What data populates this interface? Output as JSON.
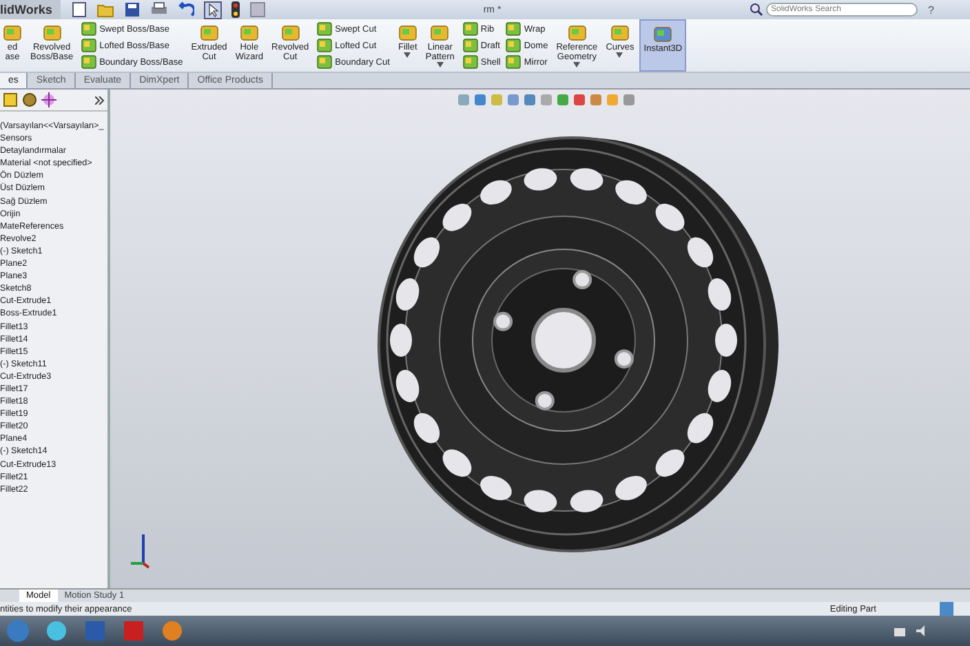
{
  "title_bar": {
    "logo": "lidWorks",
    "document_title": "rm *",
    "search": {
      "placeholder": "SolidWorks Search"
    },
    "help": "?"
  },
  "ribbon": {
    "groups": [
      {
        "kind": "big",
        "items": [
          {
            "lines": [
              "ed",
              "ase"
            ],
            "dropdown": false,
            "selected": false
          },
          {
            "lines": [
              "Revolved",
              "Boss/Base"
            ],
            "dropdown": false,
            "selected": false
          }
        ]
      },
      {
        "kind": "stack",
        "items": [
          {
            "lines": [
              "Swept Boss/Base"
            ]
          },
          {
            "lines": [
              "Lofted Boss/Base"
            ]
          },
          {
            "lines": [
              "Boundary Boss/Base"
            ]
          }
        ]
      },
      {
        "kind": "big",
        "items": [
          {
            "lines": [
              "Extruded",
              "Cut"
            ],
            "dropdown": false,
            "selected": false
          },
          {
            "lines": [
              "Hole",
              "Wizard"
            ],
            "dropdown": false,
            "selected": false
          },
          {
            "lines": [
              "Revolved",
              "Cut"
            ],
            "dropdown": false,
            "selected": false
          }
        ]
      },
      {
        "kind": "stack",
        "items": [
          {
            "lines": [
              "Swept Cut"
            ]
          },
          {
            "lines": [
              "Lofted Cut"
            ]
          },
          {
            "lines": [
              "Boundary Cut"
            ]
          }
        ]
      },
      {
        "kind": "big",
        "items": [
          {
            "lines": [
              "Fillet"
            ],
            "dropdown": true,
            "selected": false
          },
          {
            "lines": [
              "Linear",
              "Pattern"
            ],
            "dropdown": true,
            "selected": false
          }
        ]
      },
      {
        "kind": "stack",
        "items": [
          {
            "lines": [
              "Rib"
            ]
          },
          {
            "lines": [
              "Draft"
            ]
          },
          {
            "lines": [
              "Shell"
            ]
          }
        ]
      },
      {
        "kind": "stack",
        "items": [
          {
            "lines": [
              "Wrap"
            ]
          },
          {
            "lines": [
              "Dome"
            ]
          },
          {
            "lines": [
              "Mirror"
            ]
          }
        ]
      },
      {
        "kind": "big",
        "items": [
          {
            "lines": [
              "Reference",
              "Geometry"
            ],
            "dropdown": true,
            "selected": false
          },
          {
            "lines": [
              "Curves"
            ],
            "dropdown": true,
            "selected": false
          },
          {
            "lines": [
              "Instant3D"
            ],
            "dropdown": false,
            "selected": true
          }
        ]
      }
    ]
  },
  "tabs": [
    {
      "label": "es",
      "selected": true
    },
    {
      "label": "Sketch",
      "selected": false
    },
    {
      "label": "Evaluate",
      "selected": false
    },
    {
      "label": "DimXpert",
      "selected": false
    },
    {
      "label": "Office Products",
      "selected": false
    }
  ],
  "feature_tree": {
    "items": [
      "(Varsayılan<<Varsayılan>_",
      "Sensors",
      "Detaylandırmalar",
      "Material <not specified>",
      "Ön Düzlem",
      "Üst Düzlem",
      "Sağ Düzlem",
      "Orijin",
      "MateReferences",
      "Revolve2",
      "(-) Sketch1",
      "Plane2",
      "Plane3",
      "Sketch8",
      "Cut-Extrude1",
      "Boss-Extrude1",
      "Fillet13",
      "Fillet14",
      "Fillet15",
      "(-) Sketch11",
      "Cut-Extrude3",
      "Fillet17",
      "Fillet18",
      "Fillet19",
      "Fillet20",
      "Plane4",
      "(-) Sketch14",
      "Cut-Extrude13",
      "Fillet21",
      "Fillet22"
    ]
  },
  "bottom_tabs": [
    {
      "label": "Model",
      "selected": true
    },
    {
      "label": "Motion Study 1",
      "selected": false
    }
  ],
  "status_bar": {
    "message": "ntities to modify their appearance",
    "mode": "Editing Part"
  }
}
